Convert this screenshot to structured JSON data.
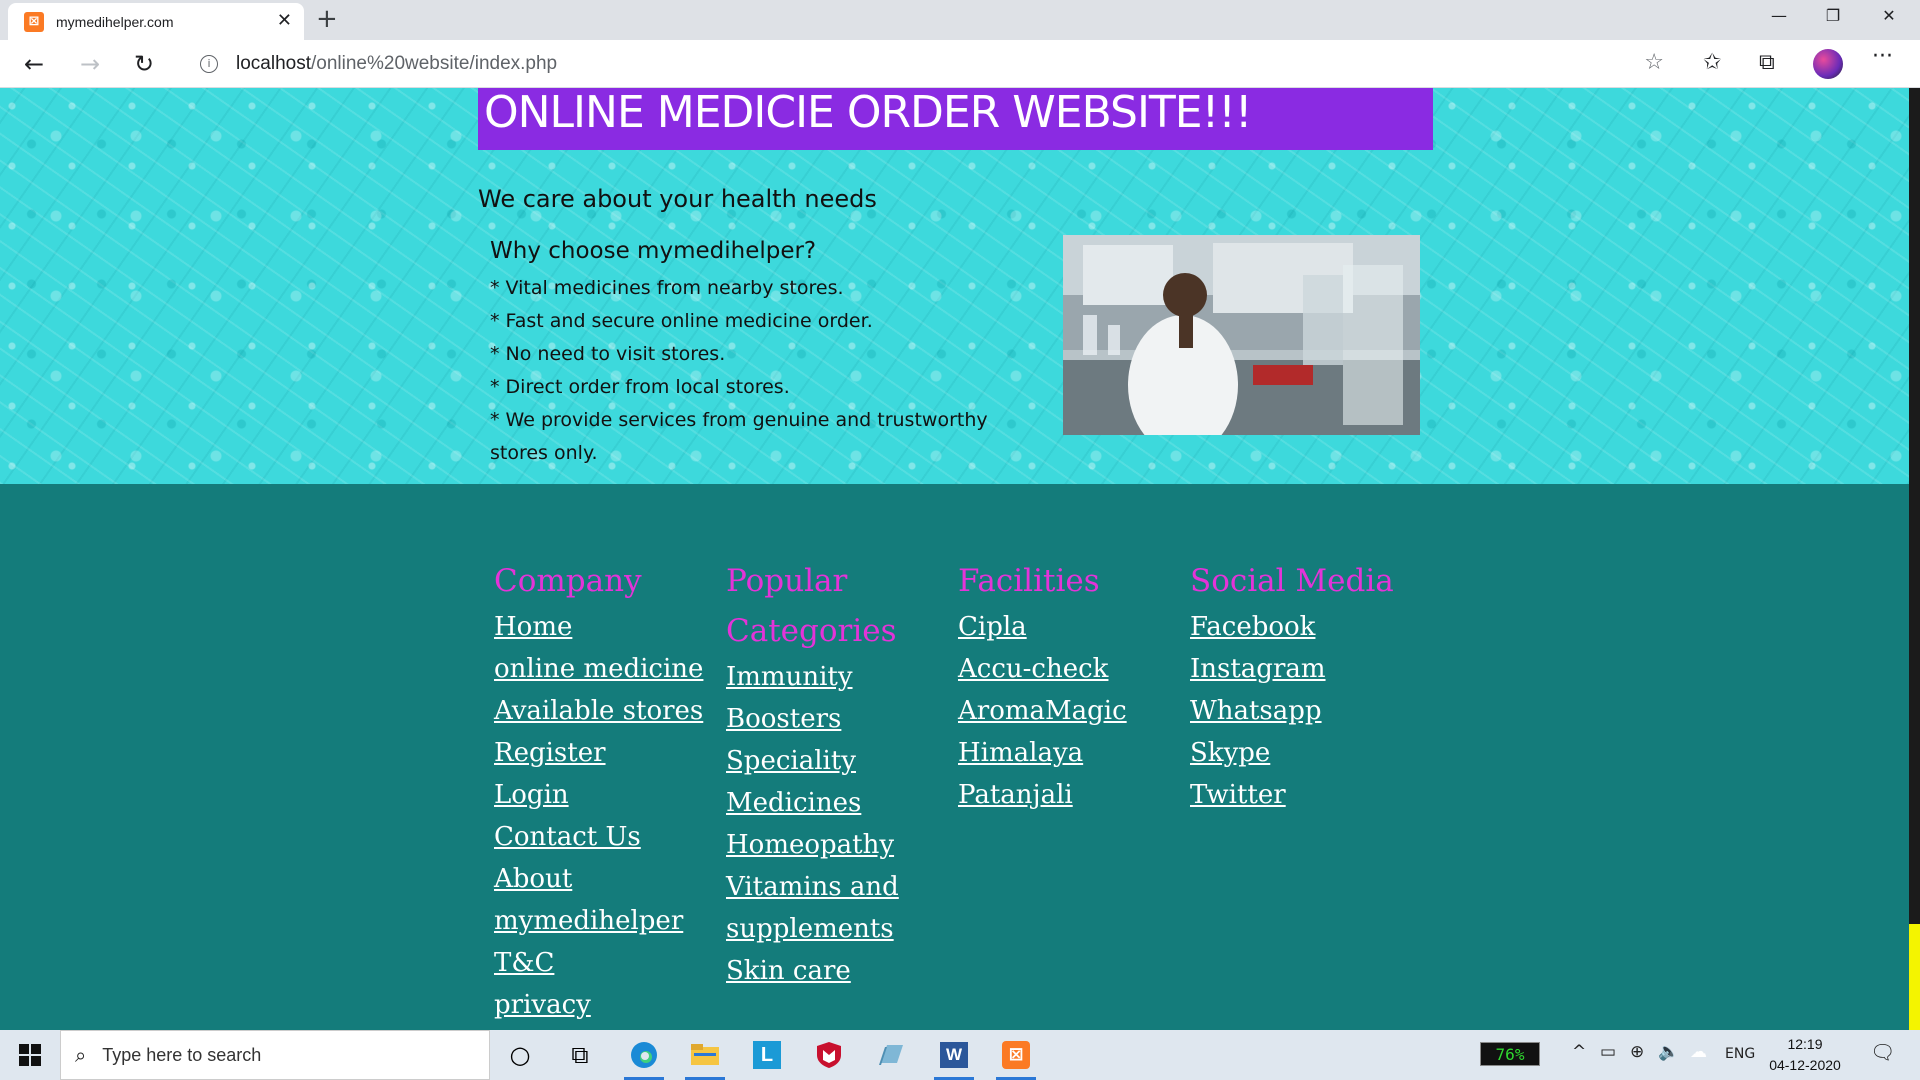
{
  "browser": {
    "tab_title": "mymedihelper.com",
    "tab_favicon": "xampp-icon",
    "url_host": "localhost",
    "url_path": "/online%20website/index.php"
  },
  "hero": {
    "banner_title": "ONLINE MEDICIE ORDER WEBSITE!!!",
    "tagline": "We care about your health needs",
    "why_heading": "Why choose mymedihelper?",
    "points": [
      "* Vital medicines from nearby stores.",
      "* Fast and secure online medicine order.",
      "* No need to visit stores.",
      "* Direct order from local stores.",
      "* We provide services from genuine and trustworthy stores only."
    ]
  },
  "footer": {
    "columns": [
      {
        "heading": "Company",
        "links": [
          "Home",
          "online medicine",
          "Available stores",
          "Register",
          "Login",
          "Contact Us",
          "About mymedihelper",
          "T&C",
          "privacy"
        ]
      },
      {
        "heading": "Popular Categories",
        "links": [
          "Immunity Boosters",
          "Speciality Medicines",
          "Homeopathy",
          "Vitamins and supplements",
          "Skin care"
        ]
      },
      {
        "heading": "Facilities",
        "links": [
          "Cipla",
          "Accu-check",
          "AromaMagic",
          "Himalaya",
          "Patanjali"
        ]
      },
      {
        "heading": "Social Media",
        "links": [
          "Facebook",
          "Instagram",
          "Whatsapp",
          "Skype",
          "Twitter"
        ]
      }
    ]
  },
  "taskbar": {
    "search_placeholder": "Type here to search",
    "battery": "76%",
    "language": "ENG",
    "time": "12:19",
    "date": "04-12-2020"
  },
  "colors": {
    "banner": "#8a2be2",
    "hero_bg": "#3dd9dc",
    "footer_bg": "#147c7b",
    "footer_heading": "#e433d8"
  }
}
